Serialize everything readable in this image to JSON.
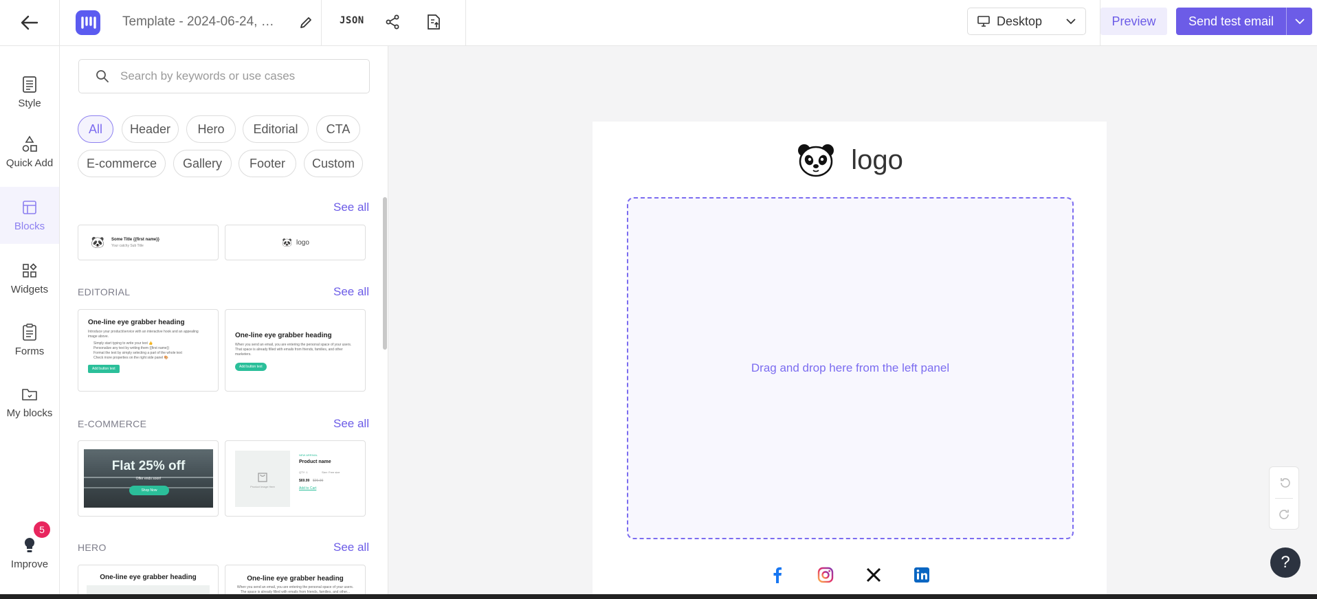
{
  "topbar": {
    "title": "Template - 2024-06-24, 02...",
    "json_label": "JSON",
    "device": "Desktop",
    "preview_label": "Preview",
    "send_label": "Send test email"
  },
  "rail": {
    "items": [
      {
        "label": "Style",
        "icon": "style-icon"
      },
      {
        "label": "Quick Add",
        "icon": "shapes-icon"
      },
      {
        "label": "Blocks",
        "icon": "blocks-icon",
        "active": true
      },
      {
        "label": "Widgets",
        "icon": "widgets-icon"
      },
      {
        "label": "Forms",
        "icon": "forms-icon"
      },
      {
        "label": "My blocks",
        "icon": "folder-icon"
      }
    ],
    "improve": {
      "label": "Improve",
      "badge": "5"
    }
  },
  "panel": {
    "search_placeholder": "Search by keywords or use cases",
    "chips": [
      "All",
      "Header",
      "Hero",
      "Editorial",
      "CTA",
      "E-commerce",
      "Gallery",
      "Footer",
      "Custom"
    ],
    "active_chip": "All",
    "see_all": "See all",
    "sections": {
      "editorial": "EDITORIAL",
      "ecommerce": "E-COMMERCE",
      "hero": "HERO"
    },
    "cards": {
      "header1_title": "Some Title {{first name}}",
      "header1_sub": "Your catchy Sub Title",
      "header2_logo": "logo",
      "editorial1_heading": "One-line eye grabber heading",
      "editorial1_text": "Introduce your product/service with an interactive hook and an appealing image above.",
      "editorial1_bullets": [
        "Simply start typing to write your text 👍",
        "Personalize any text by writing them {{first name}} ",
        "Format the text by simply selecting a part of the whole text",
        "Check more properties on the right side panel 🎨"
      ],
      "editorial1_btn": "Add button text",
      "editorial2_heading": "One-line eye grabber heading",
      "editorial2_text": "When you send an email, you are entering the personal space of your users. That space is already filled with emails from friends, families, and other marketers.",
      "editorial2_btn": "Add button text",
      "ecom1_headline": "Flat 25% off",
      "ecom1_sub": "Offer ends soon!",
      "ecom1_btn": "Shop Now",
      "ecom2_tag": "NEW ARRIVAL",
      "ecom2_name": "Product name",
      "ecom2_qty": "QTY: 1",
      "ecom2_size": "Size: Free size",
      "ecom2_price": "$69.99",
      "ecom2_old_price": "$99.99",
      "ecom2_link": "Add to Cart",
      "ecom2_img_label": "Product Image Here",
      "hero1_heading": "One-line eye grabber heading",
      "hero2_heading": "One-line eye grabber heading",
      "hero2_text": "When you send an email, you are entering the personal space of your users. The space is already filled with emails from friends, families, and other..."
    }
  },
  "canvas": {
    "logo_text": "logo",
    "dropzone_text": "Drag and drop here from the left panel",
    "socials": [
      "facebook-icon",
      "instagram-icon",
      "x-icon",
      "linkedin-icon"
    ],
    "help": "?"
  },
  "colors": {
    "accent": "#6c5ce7",
    "accent_light": "#f4f3fd",
    "badge": "#e8265e",
    "teal": "#2bbf9a"
  }
}
